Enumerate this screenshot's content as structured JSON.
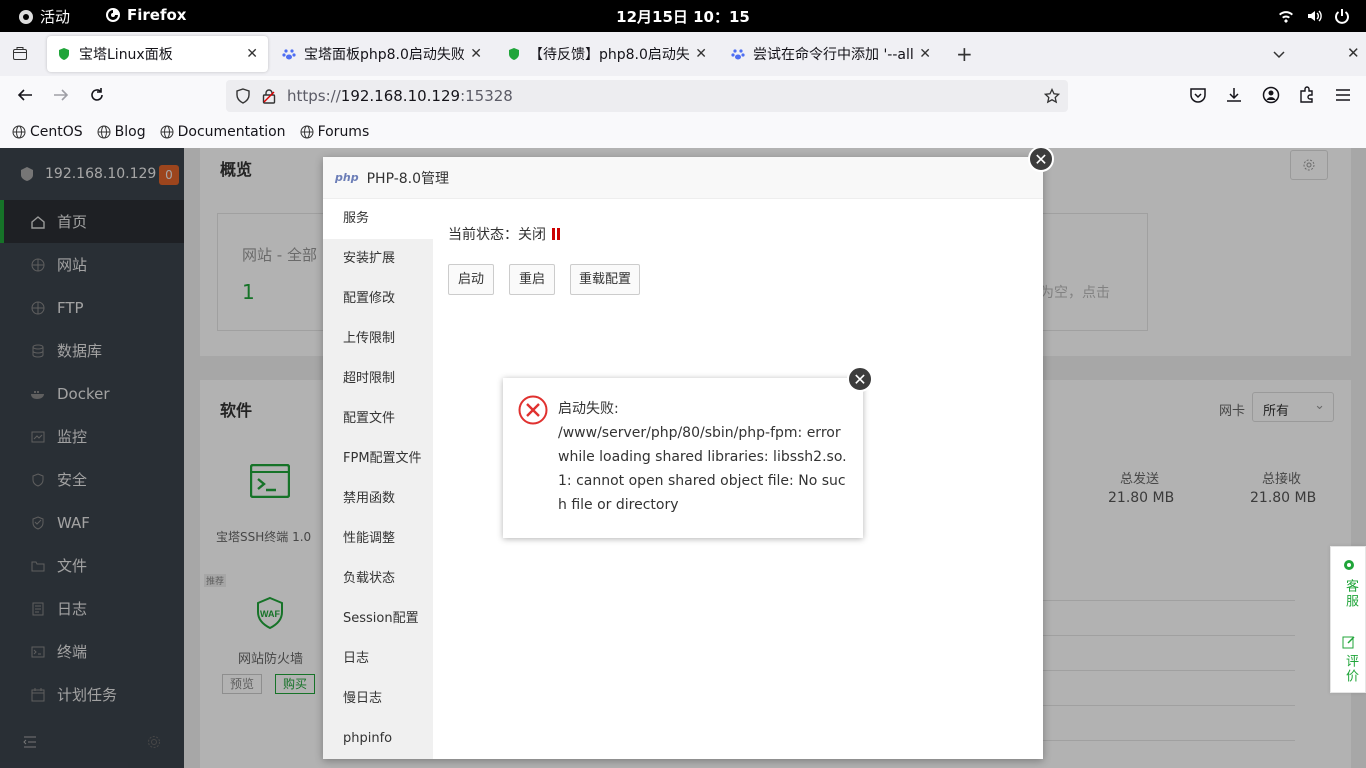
{
  "topbar": {
    "activities": "活动",
    "app": "Firefox",
    "clock": "12月15日 10：15"
  },
  "tabs": [
    {
      "title": "宝塔Linux面板",
      "icon": "shield-icon"
    },
    {
      "title": "宝塔面板php8.0启动失败",
      "icon": "paw-icon"
    },
    {
      "title": "【待反馈】php8.0启动失败",
      "icon": "shield-icon"
    },
    {
      "title": "尝试在命令行中添加 '--all",
      "icon": "paw-icon"
    }
  ],
  "url": {
    "prefix": "https://",
    "host": "192.168.10.129",
    "port": ":15328"
  },
  "bookmarks": [
    "CentOS",
    "Blog",
    "Documentation",
    "Forums"
  ],
  "sidebar": {
    "ip": "192.168.10.129",
    "badge": "0",
    "items": [
      {
        "label": "首页",
        "icon": "home-icon"
      },
      {
        "label": "网站",
        "icon": "globe-icon"
      },
      {
        "label": "FTP",
        "icon": "globe-icon"
      },
      {
        "label": "数据库",
        "icon": "database-icon"
      },
      {
        "label": "Docker",
        "icon": "docker-icon"
      },
      {
        "label": "监控",
        "icon": "monitor-icon"
      },
      {
        "label": "安全",
        "icon": "shield-icon"
      },
      {
        "label": "WAF",
        "icon": "waf-shield-icon"
      },
      {
        "label": "文件",
        "icon": "folder-icon"
      },
      {
        "label": "日志",
        "icon": "log-icon"
      },
      {
        "label": "终端",
        "icon": "terminal-icon"
      },
      {
        "label": "计划任务",
        "icon": "calendar-icon"
      }
    ]
  },
  "main": {
    "overview": "概览",
    "site_label": "网站 - 全部",
    "site_count": "1",
    "empty_hint": "为空，点击",
    "software": "软件",
    "nic_label": "网卡",
    "nic_value": "所有",
    "sent_label": "总发送",
    "sent_value": "21.80 MB",
    "recv_label": "总接收",
    "recv_value": "21.80 MB",
    "ssh_label": "宝塔SSH终端 1.0",
    "recommend": "推荐",
    "waf_label": "网站防火墙",
    "preview_btn": "预览",
    "buy_btn": "购买",
    "float_service": "客服",
    "float_review": "评价"
  },
  "layer": {
    "php_logo": "php",
    "title": "PHP-8.0管理",
    "status_label": "当前状态：关闭",
    "menu": [
      "服务",
      "安装扩展",
      "配置修改",
      "上传限制",
      "超时限制",
      "配置文件",
      "FPM配置文件",
      "禁用函数",
      "性能调整",
      "负载状态",
      "Session配置",
      "日志",
      "慢日志",
      "phpinfo"
    ],
    "buttons": {
      "start": "启动",
      "restart": "重启",
      "reload": "重载配置"
    }
  },
  "dialog": {
    "message": "启动失败:\n/www/server/php/80/sbin/php-fpm: error while loading shared libraries: libssh2.so.1: cannot open shared object file: No such file or directory"
  },
  "colors": {
    "brand_green": "#20a53a",
    "sidebar_bg": "#3c444d",
    "error_red": "#e0312f",
    "badge_orange": "#e0632a"
  }
}
